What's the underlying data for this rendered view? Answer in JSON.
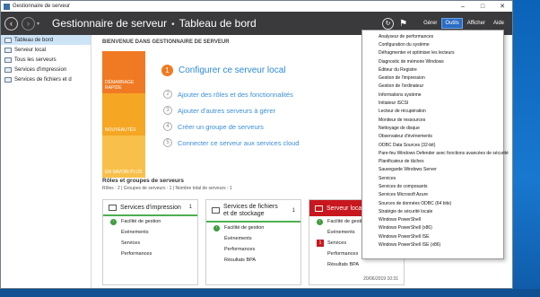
{
  "window": {
    "title": "Gestionnaire de serveur"
  },
  "header": {
    "app": "Gestionnaire de serveur",
    "separator": "•",
    "page": "Tableau de bord",
    "menus": [
      "Gérer",
      "Outils",
      "Afficher",
      "Aide"
    ],
    "active_menu": "Outils"
  },
  "sidebar": {
    "items": [
      {
        "label": "Tableau de bord",
        "active": true
      },
      {
        "label": "Serveur local",
        "active": false
      },
      {
        "label": "Tous les serveurs",
        "active": false
      },
      {
        "label": "Services d'impression",
        "active": false
      },
      {
        "label": "Services de fichiers et d",
        "active": false
      }
    ]
  },
  "welcome": {
    "title": "BIENVENUE DANS GESTIONNAIRE DE SERVEUR",
    "tiles": [
      "DÉMARRAGE RAPIDE",
      "NOUVEAUTÉS",
      "EN SAVOIR PLUS"
    ],
    "steps": [
      {
        "num": "1",
        "label": "Configurer ce serveur local"
      },
      {
        "num": "2",
        "label": "Ajouter des rôles et des fonctionnalités"
      },
      {
        "num": "3",
        "label": "Ajouter d'autres serveurs à gérer"
      },
      {
        "num": "4",
        "label": "Créer un groupe de serveurs"
      },
      {
        "num": "5",
        "label": "Connecter ce serveur aux services cloud"
      }
    ]
  },
  "groups": {
    "title": "Rôles et groupes de serveurs",
    "subtitle": "Rôles : 2  |  Groupes de serveurs : 1  |  Nombre total de serveurs : 1"
  },
  "cards": [
    {
      "title": "Services d'impression",
      "count": "1",
      "rows": [
        {
          "label": "Facilité de gestion",
          "status": "ok"
        },
        {
          "label": "Événements",
          "status": ""
        },
        {
          "label": "Services",
          "status": ""
        },
        {
          "label": "Performances",
          "status": ""
        }
      ]
    },
    {
      "title": "Services de fichiers et de stockage",
      "count": "1",
      "rows": [
        {
          "label": "Facilité de gestion",
          "status": "ok"
        },
        {
          "label": "Événements",
          "status": ""
        },
        {
          "label": "Performances",
          "status": ""
        },
        {
          "label": "Résultats BPA",
          "status": ""
        }
      ]
    },
    {
      "title": "Serveur local",
      "count": "1",
      "rows": [
        {
          "label": "Facilité de gestion",
          "status": "ok"
        },
        {
          "label": "Événements",
          "status": ""
        },
        {
          "label": "Services",
          "status": "1"
        },
        {
          "label": "Performances",
          "status": ""
        },
        {
          "label": "Résultats BPA",
          "status": ""
        }
      ],
      "timestamp": "20/06/2019 10:31"
    }
  ],
  "tools_menu": [
    "Analyseur de performances",
    "Configuration du système",
    "Défragmenter et optimiser les lecteurs",
    "Diagnostic de mémoire Windows",
    "Éditeur du Registre",
    "Gestion de l'impression",
    "Gestion de l'ordinateur",
    "Informations système",
    "Initiateur iSCSI",
    "Lecteur de récupération",
    "Moniteur de ressources",
    "Nettoyage de disque",
    "Observateur d'événements",
    "ODBC Data Sources (32-bit)",
    "Pare-feu Windows Defender avec fonctions avancées de sécurité",
    "Planificateur de tâches",
    "Sauvegarde Windows Server",
    "Services",
    "Services de composants",
    "Services Microsoft Azure",
    "Sources de données ODBC (64 bits)",
    "Stratégie de sécurité locale",
    "Windows PowerShell",
    "Windows PowerShell (x86)",
    "Windows PowerShell ISE",
    "Windows PowerShell ISE (x86)"
  ],
  "colors": {
    "header_bg": "#3a3a3c",
    "accent": "#2e8ad8",
    "tile_orange": "#f07a24",
    "status_ok": "#3e9c3e",
    "status_bad": "#c8171e"
  }
}
